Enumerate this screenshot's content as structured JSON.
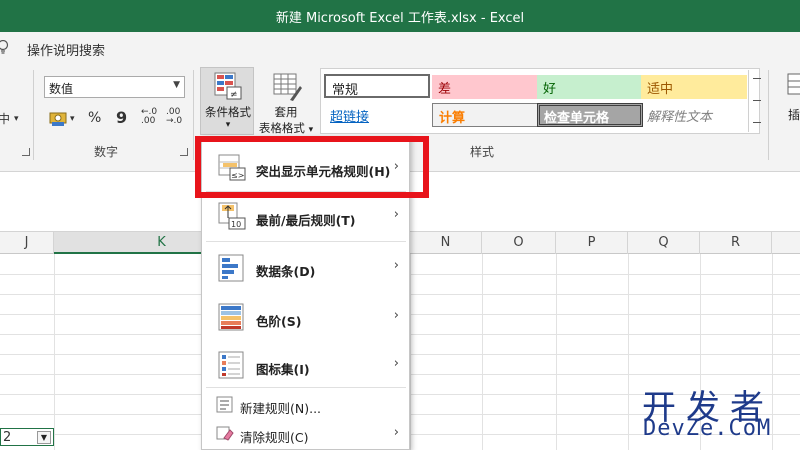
{
  "window": {
    "title": "新建 Microsoft Excel 工作表.xlsx  -  Excel"
  },
  "tellme": {
    "label": "操作说明搜索"
  },
  "ribbon": {
    "left_partial": "中",
    "number_format": "数值",
    "percent": "%",
    "comma": "9",
    "inc_dec_top": "←.0",
    "inc_dec_bottom": ".00",
    "dec_top": ".00",
    "dec_bottom": "→.0",
    "group_number": "数字",
    "cond_format": "条件格式",
    "table_format_1": "套用",
    "table_format_2": "表格格式",
    "group_styles": "样式",
    "insert_partial": "插",
    "styles": [
      {
        "label": "常规",
        "bg": "#ffffff",
        "color": "#000000"
      },
      {
        "label": "差",
        "bg": "#ffc7ce",
        "color": "#9c0006"
      },
      {
        "label": "好",
        "bg": "#c6efce",
        "color": "#006100"
      },
      {
        "label": "适中",
        "bg": "#ffeb9c",
        "color": "#9c5700"
      },
      {
        "label": "超链接",
        "bg": "#ffffff",
        "color": "#0563c1"
      },
      {
        "label": "计算",
        "bg": "#f2f2f2",
        "color": "#fa7d00"
      },
      {
        "label": "检查单元格",
        "bg": "#a5a5a5",
        "color": "#ffffff"
      },
      {
        "label": "解释性文本",
        "bg": "#ffffff",
        "color": "#7f7f7f"
      }
    ]
  },
  "grid": {
    "columns": [
      "J",
      "K",
      "N",
      "O",
      "P",
      "Q",
      "R"
    ],
    "selected_column": "K",
    "cell_value": "2"
  },
  "menu": {
    "items": [
      {
        "label": "突出显示单元格规则(H)",
        "has_sub": true
      },
      {
        "label": "最前/最后规则(T)",
        "has_sub": true
      },
      {
        "label": "数据条(D)",
        "has_sub": true
      },
      {
        "label": "色阶(S)",
        "has_sub": true
      },
      {
        "label": "图标集(I)",
        "has_sub": true
      },
      {
        "label": "新建规则(N)...",
        "has_sub": false
      },
      {
        "label": "清除规则(C)",
        "has_sub": true
      }
    ],
    "icon_10": "10"
  },
  "watermark": {
    "line1": "开发者",
    "line2": "DevZe.CoM"
  }
}
